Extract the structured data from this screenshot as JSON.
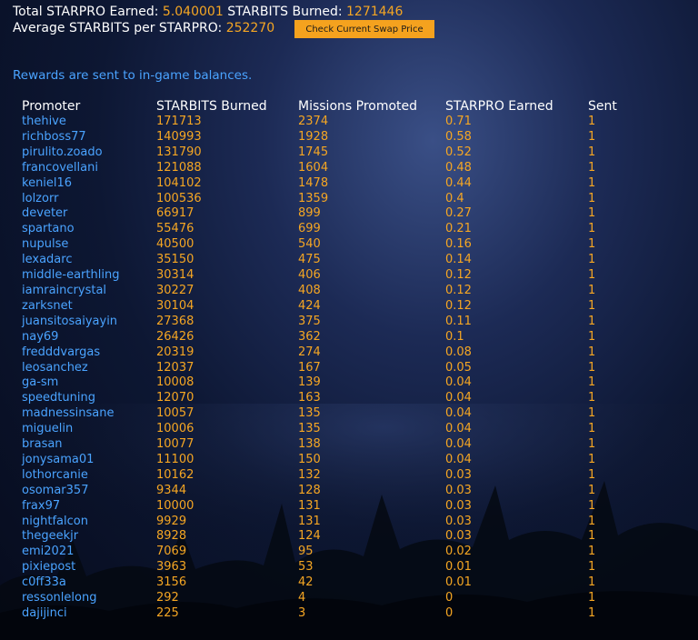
{
  "header": {
    "total_label": "Total STARPRO Earned:",
    "total_value": "5.040001",
    "burned_label": "STARBITS Burned:",
    "burned_value": "1271446",
    "avg_label": "Average STARBITS per STARPRO:",
    "avg_value": "252270",
    "swap_button": "Check Current Swap Price"
  },
  "note": "Rewards are sent to in-game balances.",
  "table": {
    "columns": [
      "Promoter",
      "STARBITS Burned",
      "Missions Promoted",
      "STARPRO Earned",
      "Sent"
    ],
    "rows": [
      [
        "thehive",
        "171713",
        "2374",
        "0.71",
        "1"
      ],
      [
        "richboss77",
        "140993",
        "1928",
        "0.58",
        "1"
      ],
      [
        "pirulito.zoado",
        "131790",
        "1745",
        "0.52",
        "1"
      ],
      [
        "francovellani",
        "121088",
        "1604",
        "0.48",
        "1"
      ],
      [
        "keniel16",
        "104102",
        "1478",
        "0.44",
        "1"
      ],
      [
        "lolzorr",
        "100536",
        "1359",
        "0.4",
        "1"
      ],
      [
        "deveter",
        "66917",
        "899",
        "0.27",
        "1"
      ],
      [
        "spartano",
        "55476",
        "699",
        "0.21",
        "1"
      ],
      [
        "nupulse",
        "40500",
        "540",
        "0.16",
        "1"
      ],
      [
        "lexadarc",
        "35150",
        "475",
        "0.14",
        "1"
      ],
      [
        "middle-earthling",
        "30314",
        "406",
        "0.12",
        "1"
      ],
      [
        "iamraincrystal",
        "30227",
        "408",
        "0.12",
        "1"
      ],
      [
        "zarksnet",
        "30104",
        "424",
        "0.12",
        "1"
      ],
      [
        "juansitosaiyayin",
        "27368",
        "375",
        "0.11",
        "1"
      ],
      [
        "nay69",
        "26426",
        "362",
        "0.1",
        "1"
      ],
      [
        "fredddvargas",
        "20319",
        "274",
        "0.08",
        "1"
      ],
      [
        "leosanchez",
        "12037",
        "167",
        "0.05",
        "1"
      ],
      [
        "ga-sm",
        "10008",
        "139",
        "0.04",
        "1"
      ],
      [
        "speedtuning",
        "12070",
        "163",
        "0.04",
        "1"
      ],
      [
        "madnessinsane",
        "10057",
        "135",
        "0.04",
        "1"
      ],
      [
        "miguelin",
        "10006",
        "135",
        "0.04",
        "1"
      ],
      [
        "brasan",
        "10077",
        "138",
        "0.04",
        "1"
      ],
      [
        "jonysama01",
        "11100",
        "150",
        "0.04",
        "1"
      ],
      [
        "lothorcanie",
        "10162",
        "132",
        "0.03",
        "1"
      ],
      [
        "osomar357",
        "9344",
        "128",
        "0.03",
        "1"
      ],
      [
        "frax97",
        "10000",
        "131",
        "0.03",
        "1"
      ],
      [
        "nightfalcon",
        "9929",
        "131",
        "0.03",
        "1"
      ],
      [
        "thegeekjr",
        "8928",
        "124",
        "0.03",
        "1"
      ],
      [
        "emi2021",
        "7069",
        "95",
        "0.02",
        "1"
      ],
      [
        "pixiepost",
        "3963",
        "53",
        "0.01",
        "1"
      ],
      [
        "c0ff33a",
        "3156",
        "42",
        "0.01",
        "1"
      ],
      [
        "ressonlelong",
        "292",
        "4",
        "0",
        "1"
      ],
      [
        "dajijinci",
        "225",
        "3",
        "0",
        "1"
      ]
    ]
  }
}
